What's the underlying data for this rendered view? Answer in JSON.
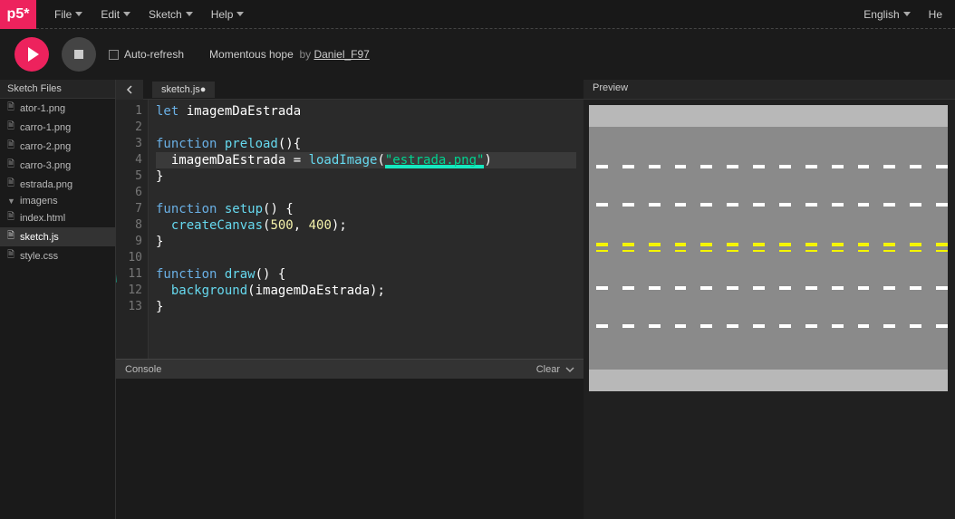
{
  "brand": "p5*",
  "menu": {
    "file": "File",
    "edit": "Edit",
    "sketch": "Sketch",
    "help": "Help",
    "english": "English",
    "he": "He"
  },
  "controls": {
    "autoRefresh": "Auto-refresh",
    "sketchName": "Momentous hope",
    "byWord": "by",
    "author": "Daniel_F97"
  },
  "sidebar": {
    "header": "Sketch Files",
    "files": [
      {
        "name": "ator-1.png",
        "type": "file"
      },
      {
        "name": "carro-1.png",
        "type": "file"
      },
      {
        "name": "carro-2.png",
        "type": "file"
      },
      {
        "name": "carro-3.png",
        "type": "file"
      },
      {
        "name": "estrada.png",
        "type": "file"
      },
      {
        "name": "imagens",
        "type": "folder"
      },
      {
        "name": "index.html",
        "type": "file"
      },
      {
        "name": "sketch.js",
        "type": "file"
      },
      {
        "name": "style.css",
        "type": "file"
      }
    ],
    "activeIndex": 7
  },
  "tab": {
    "label": "sketch.js",
    "dirty": true
  },
  "code": {
    "lines": [
      {
        "n": 1,
        "tokens": [
          {
            "t": "kw",
            "v": "let "
          },
          {
            "t": "ident",
            "v": "imagemDaEstrada"
          }
        ]
      },
      {
        "n": 2,
        "tokens": []
      },
      {
        "n": 3,
        "tokens": [
          {
            "t": "kw",
            "v": "function "
          },
          {
            "t": "fnname",
            "v": "preload"
          },
          {
            "t": "punct",
            "v": "(){"
          }
        ]
      },
      {
        "n": 4,
        "hl": true,
        "tokens": [
          {
            "t": "ident",
            "v": "  imagemDaEstrada "
          },
          {
            "t": "punct",
            "v": "= "
          },
          {
            "t": "fnname",
            "v": "loadImage"
          },
          {
            "t": "punct",
            "v": "("
          },
          {
            "t": "str",
            "v": "\"estrada.png\"",
            "underline": true
          },
          {
            "t": "punct",
            "v": ")"
          }
        ]
      },
      {
        "n": 5,
        "tokens": [
          {
            "t": "punct",
            "v": "}"
          }
        ]
      },
      {
        "n": 6,
        "tokens": []
      },
      {
        "n": 7,
        "tokens": [
          {
            "t": "kw",
            "v": "function "
          },
          {
            "t": "fnname",
            "v": "setup"
          },
          {
            "t": "punct",
            "v": "() {"
          }
        ]
      },
      {
        "n": 8,
        "tokens": [
          {
            "t": "ident",
            "v": "  "
          },
          {
            "t": "fnname",
            "v": "createCanvas"
          },
          {
            "t": "punct",
            "v": "("
          },
          {
            "t": "num",
            "v": "500"
          },
          {
            "t": "punct",
            "v": ", "
          },
          {
            "t": "num",
            "v": "400"
          },
          {
            "t": "punct",
            "v": ");"
          }
        ]
      },
      {
        "n": 9,
        "tokens": [
          {
            "t": "punct",
            "v": "}"
          }
        ]
      },
      {
        "n": 10,
        "tokens": []
      },
      {
        "n": 11,
        "tokens": [
          {
            "t": "kw",
            "v": "function "
          },
          {
            "t": "fnname",
            "v": "draw"
          },
          {
            "t": "punct",
            "v": "() {"
          }
        ]
      },
      {
        "n": 12,
        "tokens": [
          {
            "t": "ident",
            "v": "  "
          },
          {
            "t": "fnname",
            "v": "background"
          },
          {
            "t": "punct",
            "v": "("
          },
          {
            "t": "ident",
            "v": "imagemDaEstrada"
          },
          {
            "t": "punct",
            "v": ");"
          }
        ]
      },
      {
        "n": 13,
        "tokens": [
          {
            "t": "punct",
            "v": "}"
          }
        ]
      }
    ]
  },
  "console": {
    "label": "Console",
    "clear": "Clear"
  },
  "preview": {
    "label": "Preview"
  }
}
